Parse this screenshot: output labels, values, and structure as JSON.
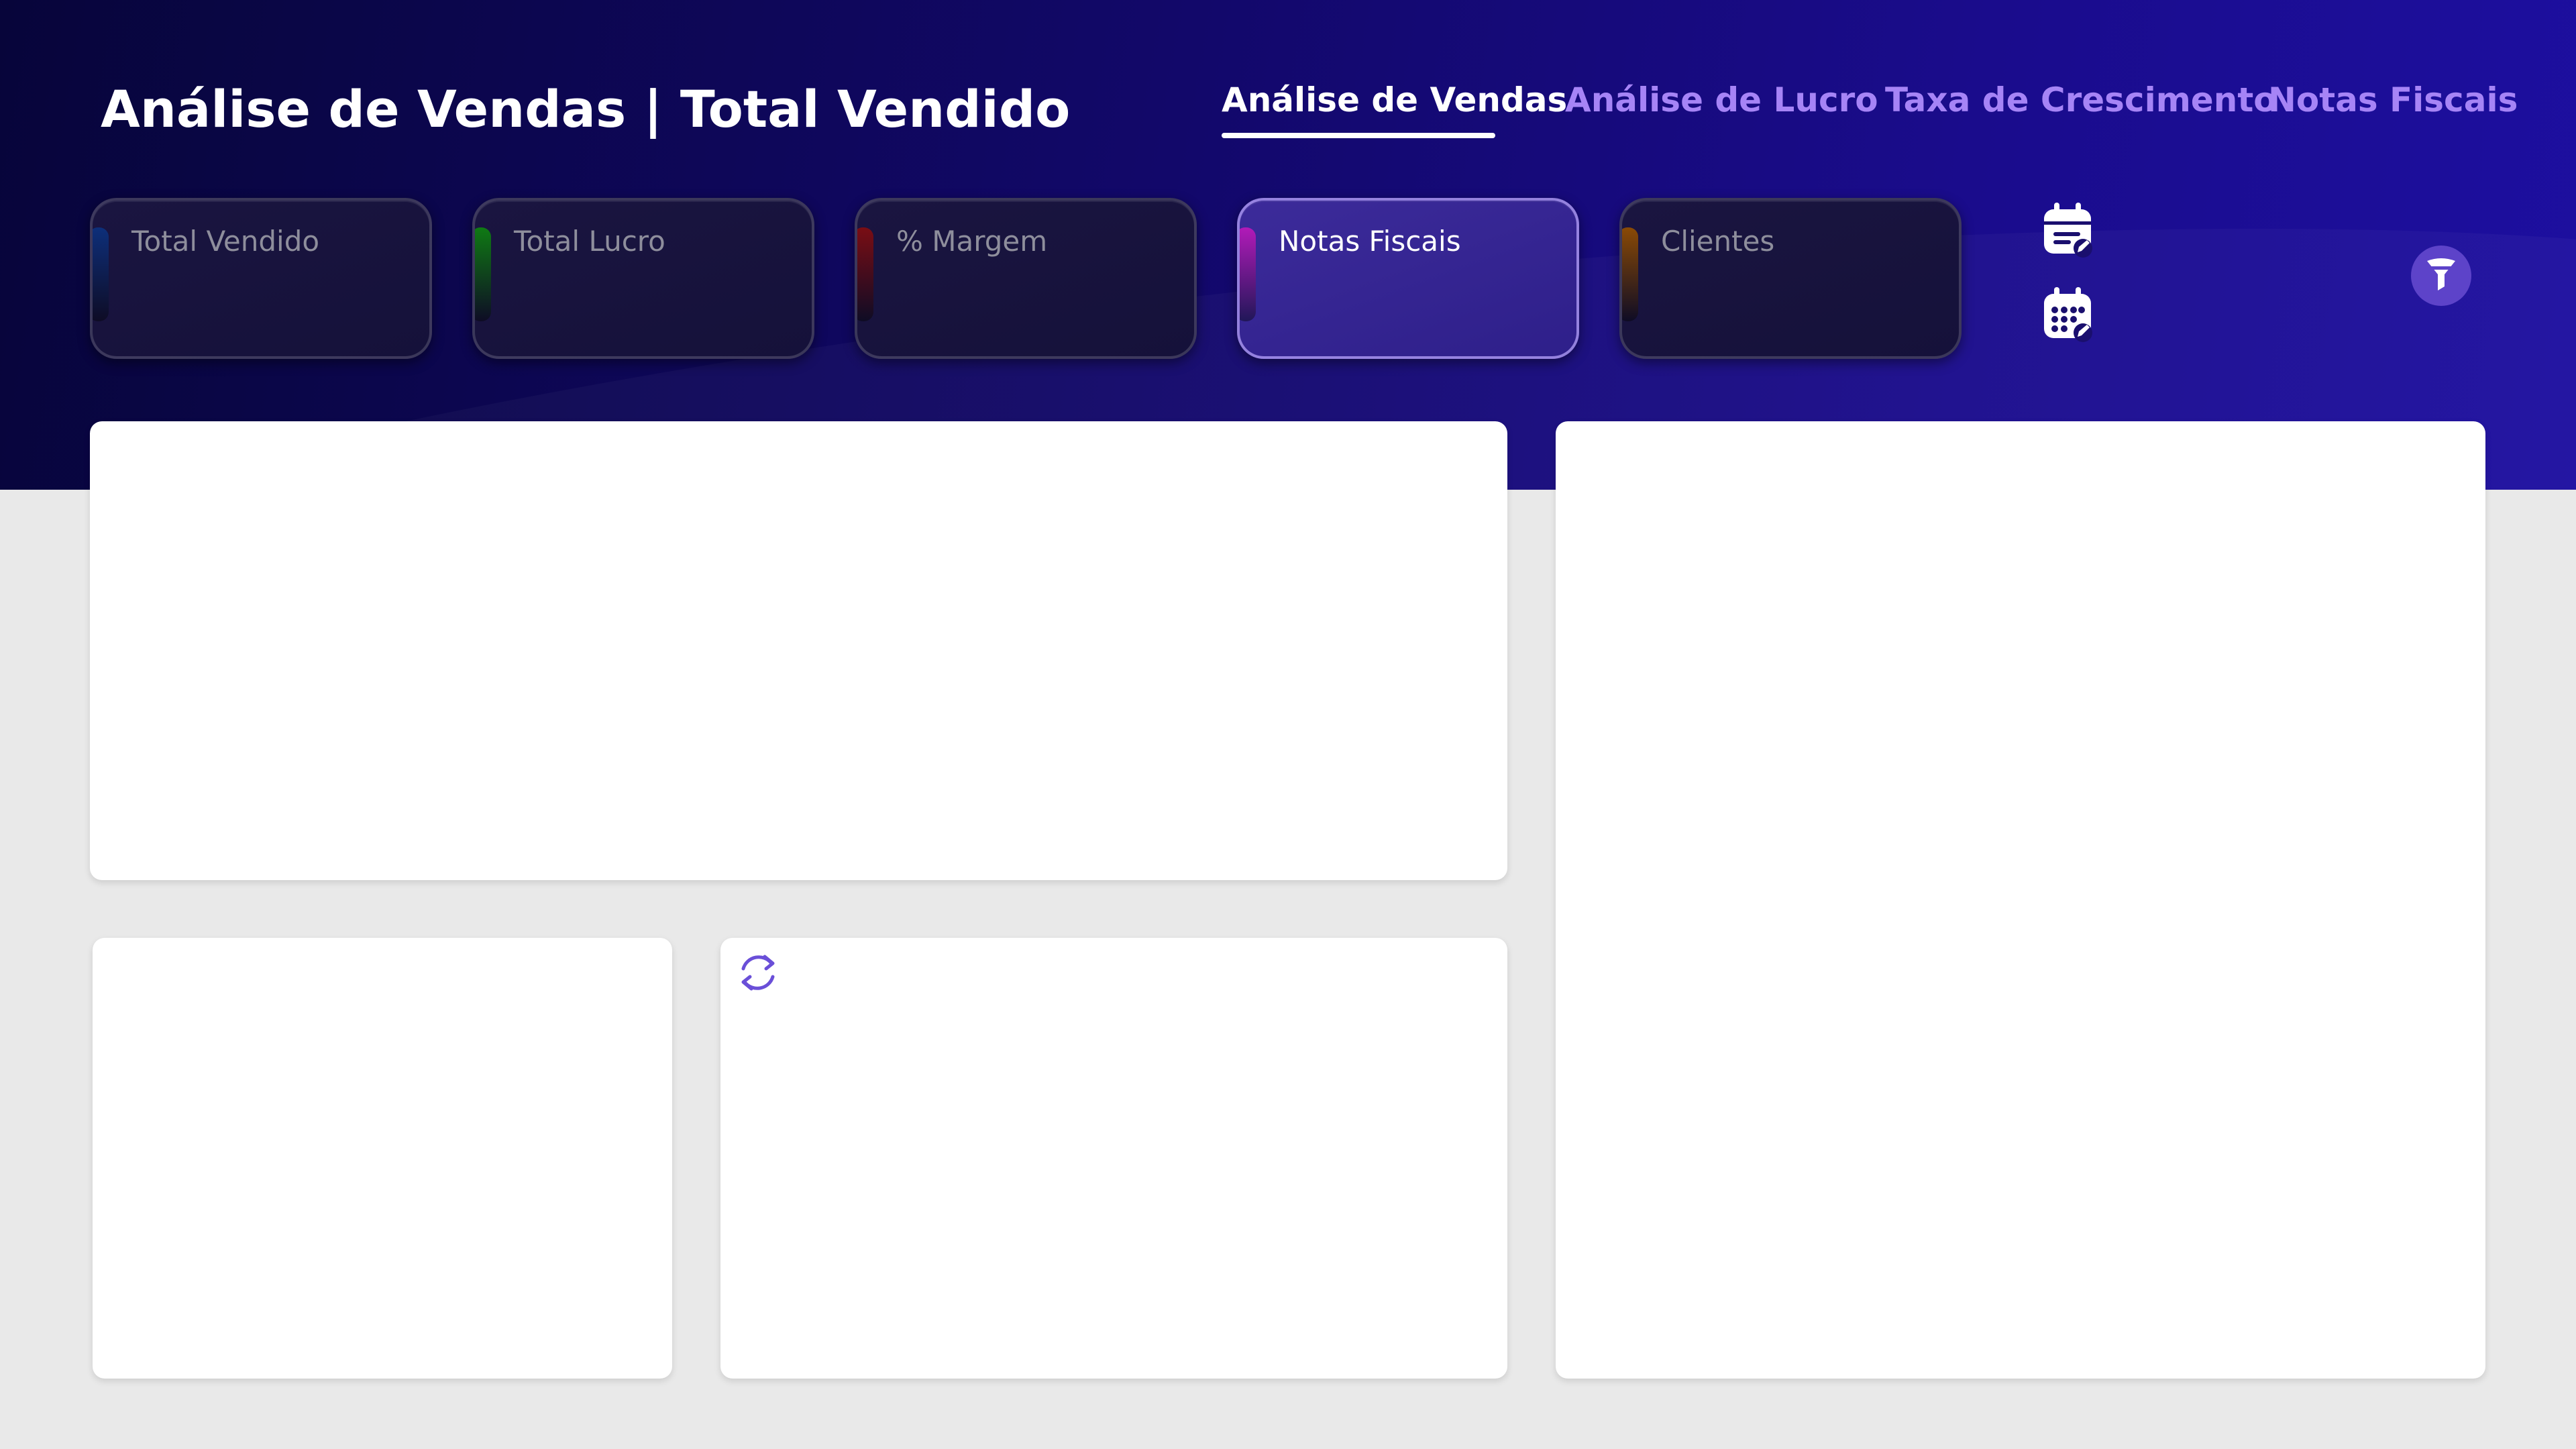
{
  "header": {
    "title": "Análise de Vendas | Total Vendido"
  },
  "nav": {
    "tabs": [
      {
        "label": "Análise de Vendas",
        "active": true
      },
      {
        "label": "Análise de Lucro",
        "active": false
      },
      {
        "label": "Taxa de Crescimento",
        "active": false
      },
      {
        "label": "Notas Fiscais",
        "active": false
      }
    ]
  },
  "kpis": [
    {
      "label": "Total Vendido",
      "accent": "#0d2f7a",
      "active": false
    },
    {
      "label": "Total Lucro",
      "accent": "#0f7a14",
      "active": false
    },
    {
      "label": "% Margem",
      "accent": "#7a0d14",
      "active": false
    },
    {
      "label": "Notas Fiscais",
      "accent": "#b21ab8",
      "active": true
    },
    {
      "label": "Clientes",
      "accent": "#8a4a05",
      "active": false
    }
  ],
  "toolbar": {
    "icons": [
      "calendar-edit-icon",
      "calendar-grid-icon",
      "filter-icon"
    ]
  },
  "panels": {
    "refresh_icon": "refresh-icon"
  },
  "colors": {
    "header_dark": "#07053a",
    "header_light": "#1d0fa0",
    "tab_inactive": "#a684f6",
    "filter_button": "#5d43c9",
    "page_background": "#e9e9e9"
  }
}
